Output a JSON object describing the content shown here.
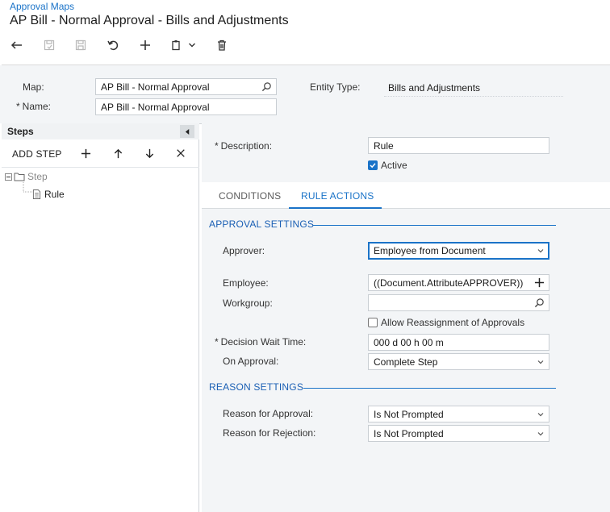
{
  "header": {
    "breadcrumb": "Approval Maps",
    "title": "AP Bill - Normal Approval - Bills and Adjustments"
  },
  "toolbar": {
    "buttons": [
      "back-icon",
      "save-close-icon",
      "save-icon",
      "undo-icon",
      "add-icon",
      "copy-paste-icon",
      "delete-icon"
    ]
  },
  "form": {
    "map_label": "Map:",
    "map_value": "AP Bill - Normal Approval",
    "name_label": "Name:",
    "name_value": "AP Bill - Normal Approval",
    "entity_type_label": "Entity Type:",
    "entity_type_value": "Bills and Adjustments",
    "required_marker": "*"
  },
  "steps": {
    "title": "Steps",
    "add_step_label": "ADD STEP",
    "tree": [
      {
        "label": "Step",
        "type": "folder"
      },
      {
        "label": "Rule",
        "type": "document"
      }
    ]
  },
  "detail": {
    "description_label": "Description:",
    "description_value": "Rule",
    "active_label": "Active",
    "active_checked": true,
    "tabs": [
      {
        "label": "CONDITIONS",
        "active": false
      },
      {
        "label": "RULE ACTIONS",
        "active": true
      }
    ]
  },
  "approval_settings": {
    "title": "APPROVAL SETTINGS",
    "approver_label": "Approver:",
    "approver_value": "Employee from Document",
    "employee_label": "Employee:",
    "employee_value": "((Document.AttributeAPPROVER))",
    "workgroup_label": "Workgroup:",
    "workgroup_value": "",
    "allow_reassign_label": "Allow Reassignment of Approvals",
    "allow_reassign_checked": false,
    "decision_wait_label": "Decision Wait Time:",
    "decision_wait_value": "000 d 00 h 00 m",
    "on_approval_label": "On Approval:",
    "on_approval_value": "Complete Step"
  },
  "reason_settings": {
    "title": "REASON SETTINGS",
    "reason_approval_label": "Reason for Approval:",
    "reason_approval_value": "Is Not Prompted",
    "reason_rejection_label": "Reason for Rejection:",
    "reason_rejection_value": "Is Not Prompted"
  },
  "colors": {
    "accent": "#1a73c8",
    "panel_bg": "#f3f5f7",
    "border": "#c9ced3"
  }
}
